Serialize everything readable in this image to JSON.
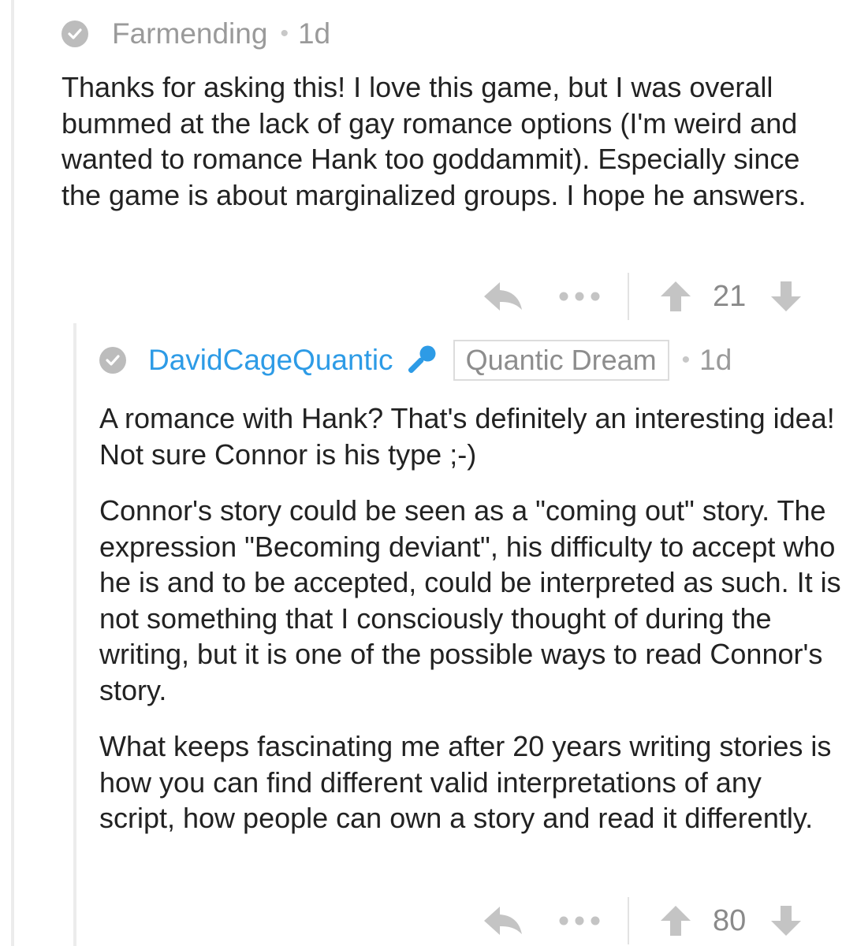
{
  "comments": [
    {
      "author": "Farmending",
      "separator": "•",
      "time": "1d",
      "paragraphs": [
        "Thanks for asking this! I love this game, but I was overall bummed at the lack of gay romance options (I'm weird and wanted to romance Hank too goddammit). Especially since the game is about marginalized groups. I hope he answers."
      ],
      "score": "21"
    },
    {
      "author": "DavidCageQuantic",
      "flair": "Quantic Dream",
      "separator": "•",
      "time": "1d",
      "paragraphs": [
        "A romance with Hank? That's definitely an interesting idea! Not sure Connor is his type ;-)",
        "Connor's story could be seen as a \"coming out\" story. The expression \"Becoming deviant\", his difficulty to accept who he is and to be accepted, could be interpreted as such. It is not something that I consciously thought of during the writing, but it is one of the possible ways to read Connor's story.",
        "What keeps fascinating me after 20 years writing stories is how you can find different valid interpretations of any script, how people can own a story and read it differently."
      ],
      "score": "80"
    }
  ],
  "icons": {
    "collapse": "check-circle-icon",
    "op_badge": "microphone-icon",
    "reply": "reply-arrow-icon",
    "more": "more-dots-icon",
    "upvote": "upvote-arrow-icon",
    "downvote": "downvote-arrow-icon"
  },
  "colors": {
    "op_author": "#2d9be6",
    "muted_text": "#9a9a9a",
    "icon_gray": "#bcbcbc"
  }
}
